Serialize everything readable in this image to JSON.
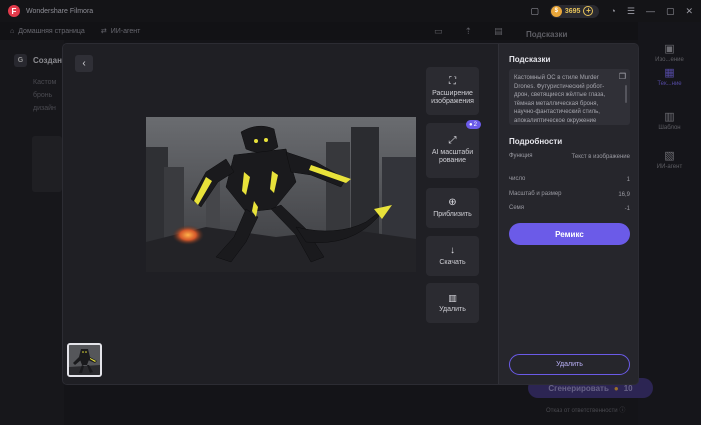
{
  "app": {
    "title": "Wondershare Filmora",
    "coins": "3695",
    "coin_symbol": "$",
    "logo_letter": "F"
  },
  "nav": {
    "home": "Домашняя страница",
    "agent": "ИИ-агент",
    "home_icon": "home-icon",
    "agent_icon": "link-icon"
  },
  "background": {
    "left_letter": "G",
    "left_title": "Создан",
    "left_lines": [
      "Кастом",
      "бронь",
      "дизайн"
    ],
    "panel_title": "Подсказки",
    "generate_label": "Сгенерировать",
    "generate_cost": "10",
    "disclaimer": "Отказ от ответственности"
  },
  "right_sidebar": [
    {
      "label": "Изо...ение",
      "icon": "image-icon",
      "active": false
    },
    {
      "label": "Тек...ние",
      "icon": "text-icon",
      "active": true
    },
    {
      "label": "Шаблон",
      "icon": "template-icon",
      "active": false
    },
    {
      "label": "ИИ-агент",
      "icon": "agent-icon",
      "active": false
    }
  ],
  "tools": [
    {
      "label": "Расширение изображения",
      "icon": "expand-image-icon",
      "glyph": "⛶"
    },
    {
      "label": "AI масштабирование",
      "icon": "upscale-icon",
      "glyph": "⤢",
      "badge": "2"
    },
    {
      "label": "Приблизить",
      "icon": "zoom-in-icon",
      "glyph": "⊕"
    },
    {
      "label": "Скачать",
      "icon": "download-icon",
      "glyph": "↓"
    },
    {
      "label": "Удалить",
      "icon": "trash-icon",
      "glyph": "🗑"
    }
  ],
  "panel": {
    "prompts_title": "Подсказки",
    "prompt_text": "Кастомный ОС в стиле Murder Drones. Футуристический робот-дрон, светящиеся жёлтые глаза, тёмная металлическая броня, научно-фантастический стиль, апокалиптическое окружение",
    "details_title": "Подробности",
    "details": [
      {
        "label": "Функция",
        "value": "Текст в изображение"
      },
      {
        "label": "число",
        "value": "1"
      },
      {
        "label": "Масштаб и размер",
        "value": "16,9"
      },
      {
        "label": "Семя",
        "value": "-1"
      }
    ],
    "remix_label": "Ремикс",
    "delete_label": "Удалить"
  },
  "colors": {
    "accent": "#6b5be8",
    "glow": "#e8e23a"
  }
}
